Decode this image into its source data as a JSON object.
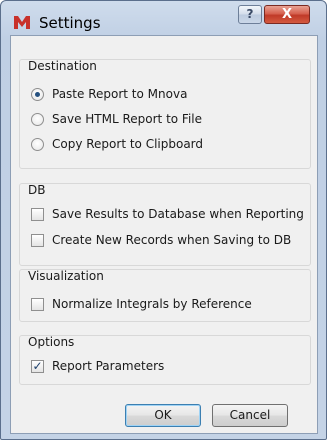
{
  "window": {
    "title": "Settings",
    "help_button": "?",
    "close_button": "X"
  },
  "destination": {
    "title": "Destination",
    "options": [
      {
        "label": "Paste Report to Mnova",
        "selected": true
      },
      {
        "label": "Save HTML Report to File",
        "selected": false
      },
      {
        "label": "Copy Report to Clipboard",
        "selected": false
      }
    ]
  },
  "db": {
    "title": "DB",
    "options": [
      {
        "label": "Save Results to Database when Reporting",
        "checked": false
      },
      {
        "label": "Create New Records when Saving to DB",
        "checked": false
      }
    ]
  },
  "visualization": {
    "title": "Visualization",
    "options": [
      {
        "label": "Normalize Integrals by Reference",
        "checked": false
      }
    ]
  },
  "options_group": {
    "title": "Options",
    "options": [
      {
        "label": "Report Parameters",
        "checked": true,
        "mark": "✓"
      }
    ]
  },
  "buttons": {
    "ok": "OK",
    "cancel": "Cancel"
  },
  "colors": {
    "accent": "#25507f",
    "close_red": "#c03a28",
    "icon_red": "#c8312b"
  }
}
